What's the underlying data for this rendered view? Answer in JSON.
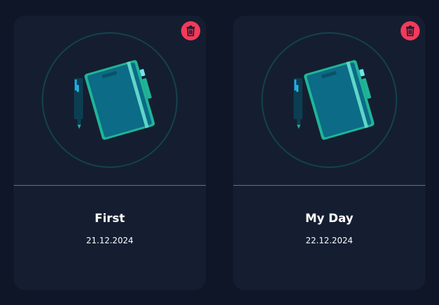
{
  "notes": [
    {
      "title": "First",
      "date": "21.12.2024",
      "illustration_icon": "notebook-pen-icon",
      "delete_icon": "trash-icon"
    },
    {
      "title": "My Day",
      "date": "22.12.2024",
      "illustration_icon": "notebook-pen-icon",
      "delete_icon": "trash-icon"
    }
  ],
  "colors": {
    "background": "#0f1628",
    "card": "#151e31",
    "divider": "#2a86c4",
    "delete": "#f43a5b",
    "notebook": "#0c6b86",
    "notebook_edge": "#1fb597",
    "circle": "#12434f"
  }
}
